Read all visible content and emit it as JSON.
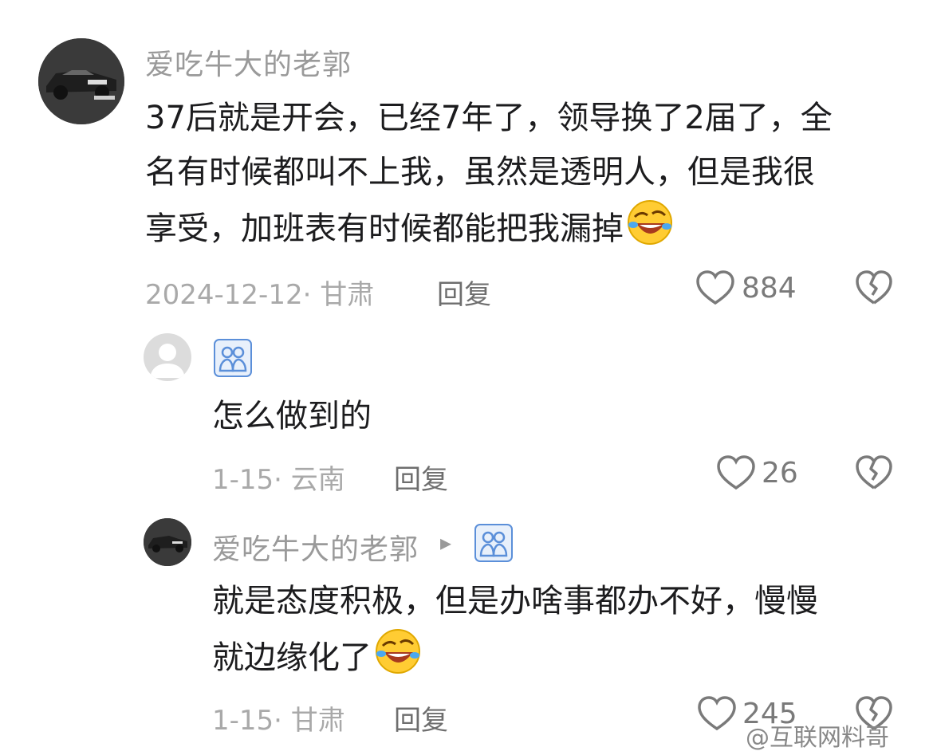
{
  "comment": {
    "username": "爱吃牛大的老郭",
    "lines": [
      "37后就是开会，已经7年了，领导换了2届了，全",
      "名有时候都叫不上我，虽然是透明人，但是我很",
      "享受，加班表有时候都能把我漏掉"
    ],
    "meta": "2024-12-12· 甘肃",
    "reply_label": "回复",
    "likes": "884",
    "emoji": "rolling-laughing-emoji"
  },
  "replies": [
    {
      "username": "",
      "badge": "friends-badge-icon",
      "text": "怎么做到的",
      "meta": "1-15· 云南",
      "reply_label": "回复",
      "likes": "26"
    },
    {
      "username": "爱吃牛大的老郭",
      "arrow": "▸",
      "badge": "friends-badge-icon",
      "lines": [
        "就是态度积极，但是办啥事都办不好，慢慢",
        "就边缘化了"
      ],
      "meta": "1-15· 甘肃",
      "reply_label": "回复",
      "likes": "245",
      "emoji": "rolling-laughing-emoji"
    }
  ],
  "watermark": "@互联网料哥",
  "colors": {
    "badge_blue": "#5b8fd9",
    "emoji_yellow": "#ffcc33",
    "text_primary": "#1c1c1e",
    "text_meta": "#a9a9a9"
  }
}
